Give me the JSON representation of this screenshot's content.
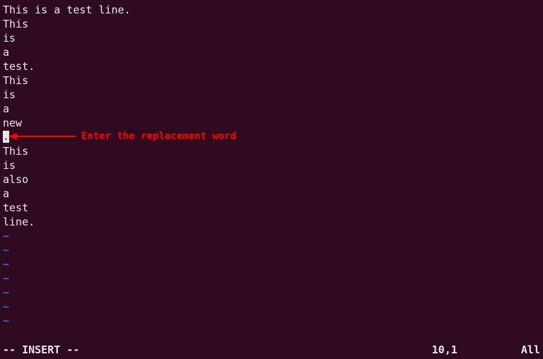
{
  "editor": {
    "lines": [
      "This is a test line.",
      "This",
      "is",
      "a",
      "test.",
      "This",
      "is",
      "a",
      "new",
      ".",
      "This",
      "is",
      "also",
      "a",
      "test",
      "line."
    ],
    "cursor_line_index": 9,
    "cursor_char": ".",
    "tilde_char": "~",
    "tilde_count": 7
  },
  "annotation": {
    "text": "Enter the replacement word"
  },
  "status": {
    "mode": "-- INSERT --",
    "position": "10,1",
    "scroll": "All"
  }
}
